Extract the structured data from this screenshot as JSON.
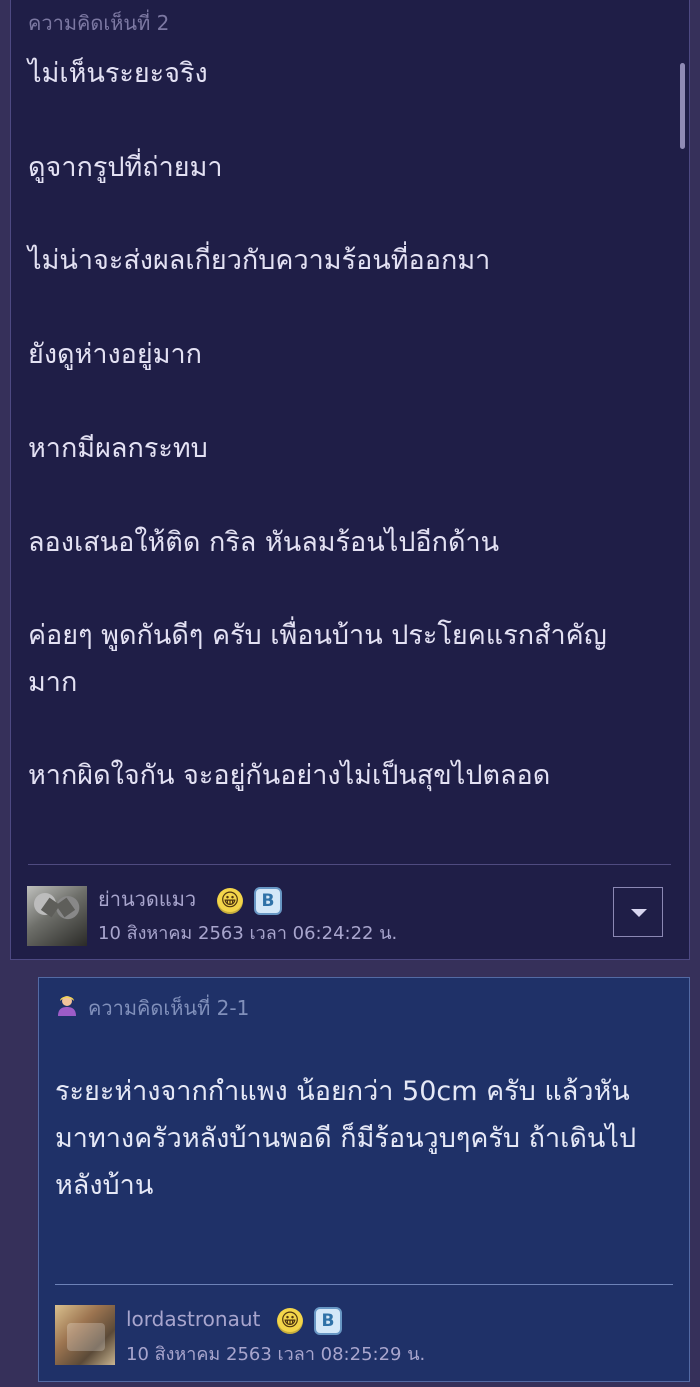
{
  "comment": {
    "number_label": "ความคิดเห็นที่ 2",
    "lines": [
      "ไม่เห็นระยะจริง",
      "ดูจากรูปที่ถ่ายมา",
      "ไม่น่าจะส่งผลเกี่ยวกับความร้อนที่ออกมา",
      "ยังดูห่างอยู่มาก",
      "หากมีผลกระทบ",
      "ลองเสนอให้ติด กริล หันลมร้อนไปอีกด้าน",
      "ค่อยๆ พูดกันดีๆ ครับ เพื่อนบ้าน ประโยคแรกสำคัญ",
      "มาก",
      "หากผิดใจกัน จะอยู่กันอย่างไม่เป็นสุขไปตลอด"
    ],
    "author": {
      "name": "ย่านวดแมว",
      "timestamp": "10 สิงหาคม 2563 เวลา 06:24:22 น.",
      "emoji": "😀",
      "badge": "B"
    },
    "menu_icon": "chevron-down-icon"
  },
  "reply": {
    "number_label": "ความคิดเห็นที่ 2-1",
    "lines": [
      "ระยะห่างจากกำแพง น้อยกว่า 50cm ครับ แล้วหัน",
      "มาทางครัวหลังบ้านพอดี ก็มีร้อนวูบๆครับ ถ้าเดินไป",
      "หลังบ้าน"
    ],
    "author": {
      "name": "lordastronaut",
      "timestamp": "10 สิงหาคม 2563 เวลา 08:25:29 น.",
      "emoji": "😀",
      "badge": "B"
    },
    "title_icon": "user-icon"
  },
  "colors": {
    "background": "#36305a",
    "comment_card": "#1f1e47",
    "reply_card": "#1f3168",
    "text": "#e3e1f3",
    "muted_text": "#a8a5cd"
  }
}
